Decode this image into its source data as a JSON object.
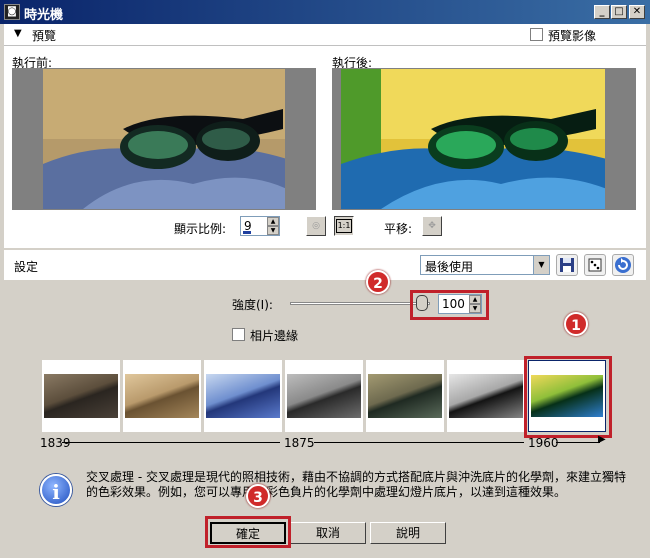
{
  "window": {
    "title": "時光機"
  },
  "header": {
    "preview_label": "預覽",
    "preview_image_label": "預覽影像"
  },
  "preview": {
    "before_label": "執行前:",
    "after_label": "執行後:",
    "zoom_label": "顯示比例:",
    "zoom_value": "9",
    "one_to_one_label": "1:1",
    "pan_label": "平移:"
  },
  "settings": {
    "title": "設定",
    "preset_value": "最後使用",
    "strength_label": "強度(I):",
    "strength_value": "100",
    "strength_level": 1.0,
    "edges_label": "相片邊緣"
  },
  "thumbnails": [
    {
      "style": "sepia-dark"
    },
    {
      "style": "sepia-light"
    },
    {
      "style": "cyanotype"
    },
    {
      "style": "gray"
    },
    {
      "style": "olive"
    },
    {
      "style": "bw"
    },
    {
      "style": "cross-process",
      "selected": true
    }
  ],
  "timeline": {
    "start": "1839",
    "mid": "1875",
    "end": "1960"
  },
  "description": "交叉處理 - 交叉處理是現代的照相技術，藉由不協調的方式搭配底片與沖洗底片的化學劑，來建立獨特的色彩效果。例如，您可以專用於彩色負片的化學劑中處理幻燈片底片，以達到這種效果。",
  "buttons": {
    "ok": "確定",
    "cancel": "取消",
    "help": "說明"
  },
  "annotations": {
    "badge_1": "1",
    "badge_2": "2",
    "badge_3": "3"
  },
  "colors": {
    "highlight": "#c0202a",
    "title_bar": "#0a246a"
  }
}
